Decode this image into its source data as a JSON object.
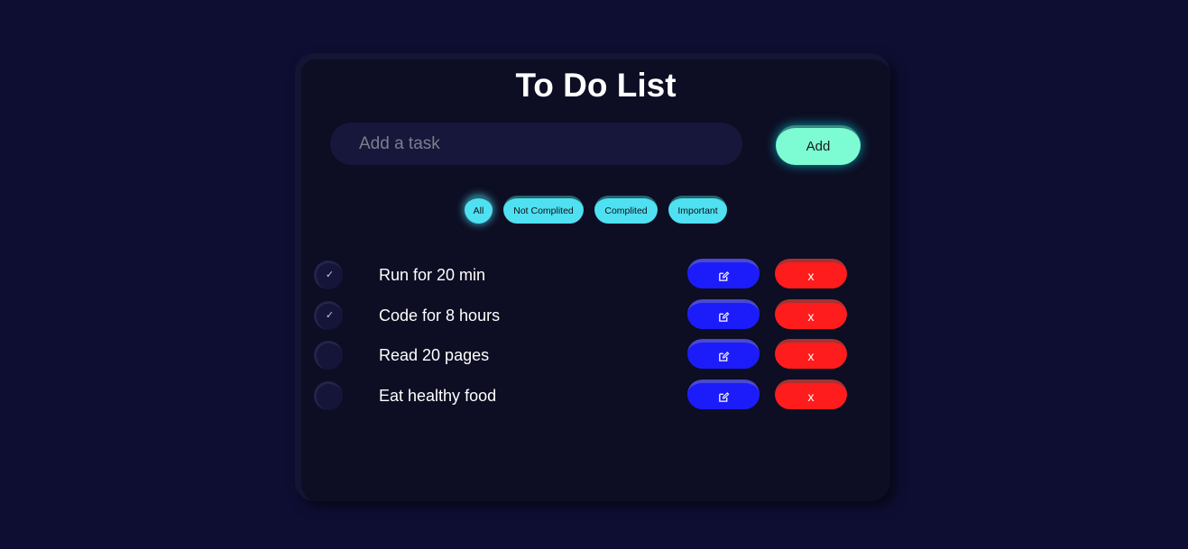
{
  "app": {
    "title": "To Do List"
  },
  "input": {
    "placeholder": "Add a task",
    "value": ""
  },
  "add_button": {
    "label": "Add"
  },
  "filters": [
    {
      "label": "All",
      "active": true
    },
    {
      "label": "Not Complited",
      "active": false
    },
    {
      "label": "Complited",
      "active": false
    },
    {
      "label": "Important",
      "active": false
    }
  ],
  "tasks": [
    {
      "text": "Run for 20 min",
      "completed": true,
      "check_glyph": "✓"
    },
    {
      "text": "Code for 8 hours",
      "completed": true,
      "check_glyph": "✓"
    },
    {
      "text": "Read 20 pages",
      "completed": false,
      "check_glyph": ""
    },
    {
      "text": "Eat healthy food",
      "completed": false,
      "check_glyph": ""
    }
  ],
  "row_actions": {
    "edit_icon": "edit-icon",
    "delete_label": "x"
  },
  "colors": {
    "background": "#0e0e33",
    "card": "#0d0d23",
    "accent_add": "#7dfcd3",
    "filter": "#4fe0f2",
    "edit": "#1c1cfb",
    "delete": "#ff1c1c"
  }
}
